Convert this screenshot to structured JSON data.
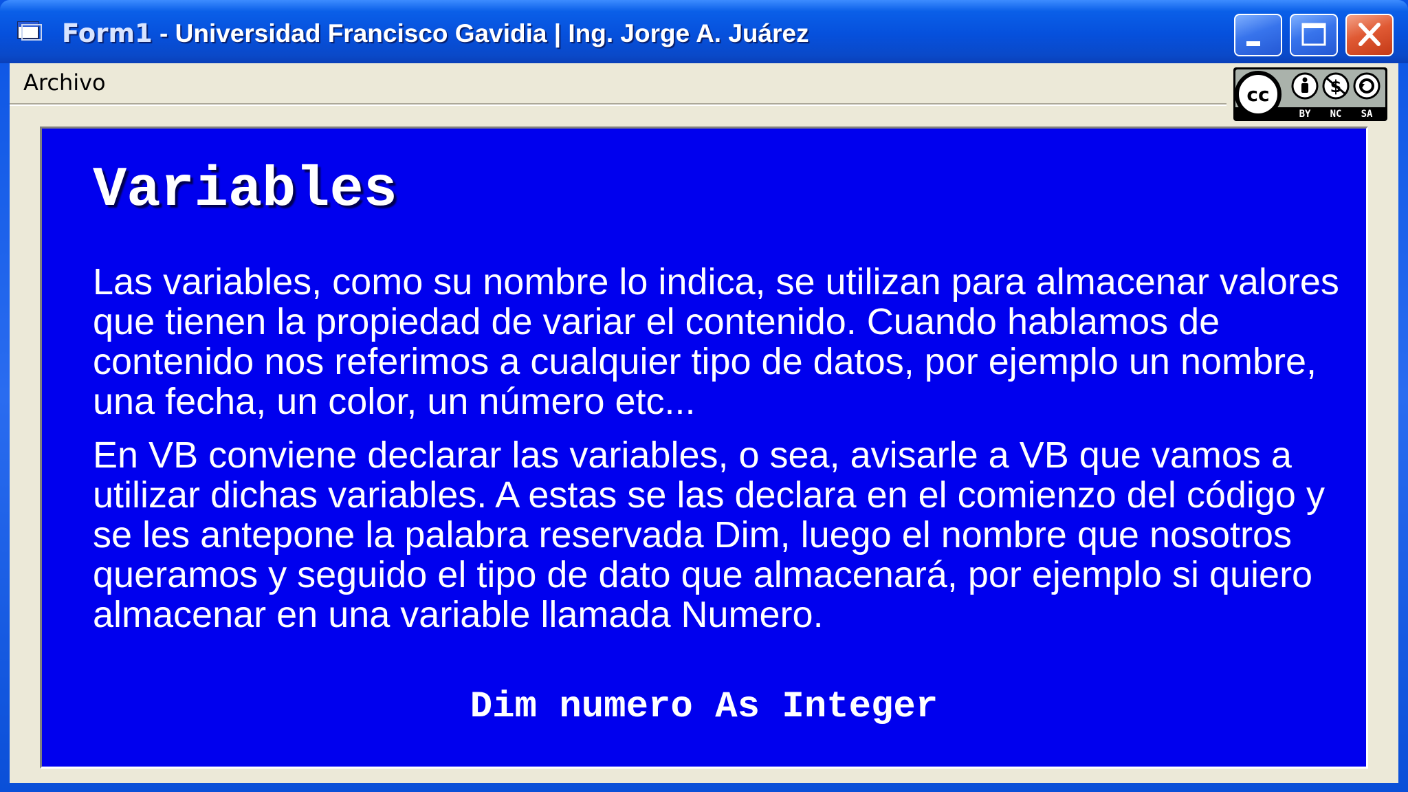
{
  "window": {
    "title_form": "Form1",
    "title_rest": " - Universidad Francisco Gavidia | Ing. Jorge A. Juárez",
    "controls": [
      "minimize-icon",
      "maximize-icon",
      "close-icon"
    ],
    "accent_color": "#0650dc",
    "close_color": "#e05a34"
  },
  "menu": {
    "items": [
      {
        "label": "Archivo"
      }
    ]
  },
  "license_badge": {
    "logo_text": "cc",
    "terms": [
      "BY",
      "NC",
      "SA"
    ]
  },
  "content": {
    "background_color": "#0000ee",
    "heading": "Variables",
    "paragraphs": [
      "Las variables, como su nombre lo indica, se utilizan para almacenar valores que tienen la propiedad de variar el contenido. Cuando hablamos de contenido nos referimos a cualquier tipo de datos, por ejemplo un nombre, una fecha, un color, un número etc...",
      "En VB conviene declarar las variables, o sea, avisarle a VB que vamos a utilizar dichas variables. A estas se las declara en el comienzo del código y se les antepone la palabra reservada Dim, luego el nombre que nosotros queramos y seguido el tipo de dato que almacenará, por ejemplo si quiero almacenar en una variable llamada Numero."
    ],
    "code": "Dim numero As Integer"
  }
}
